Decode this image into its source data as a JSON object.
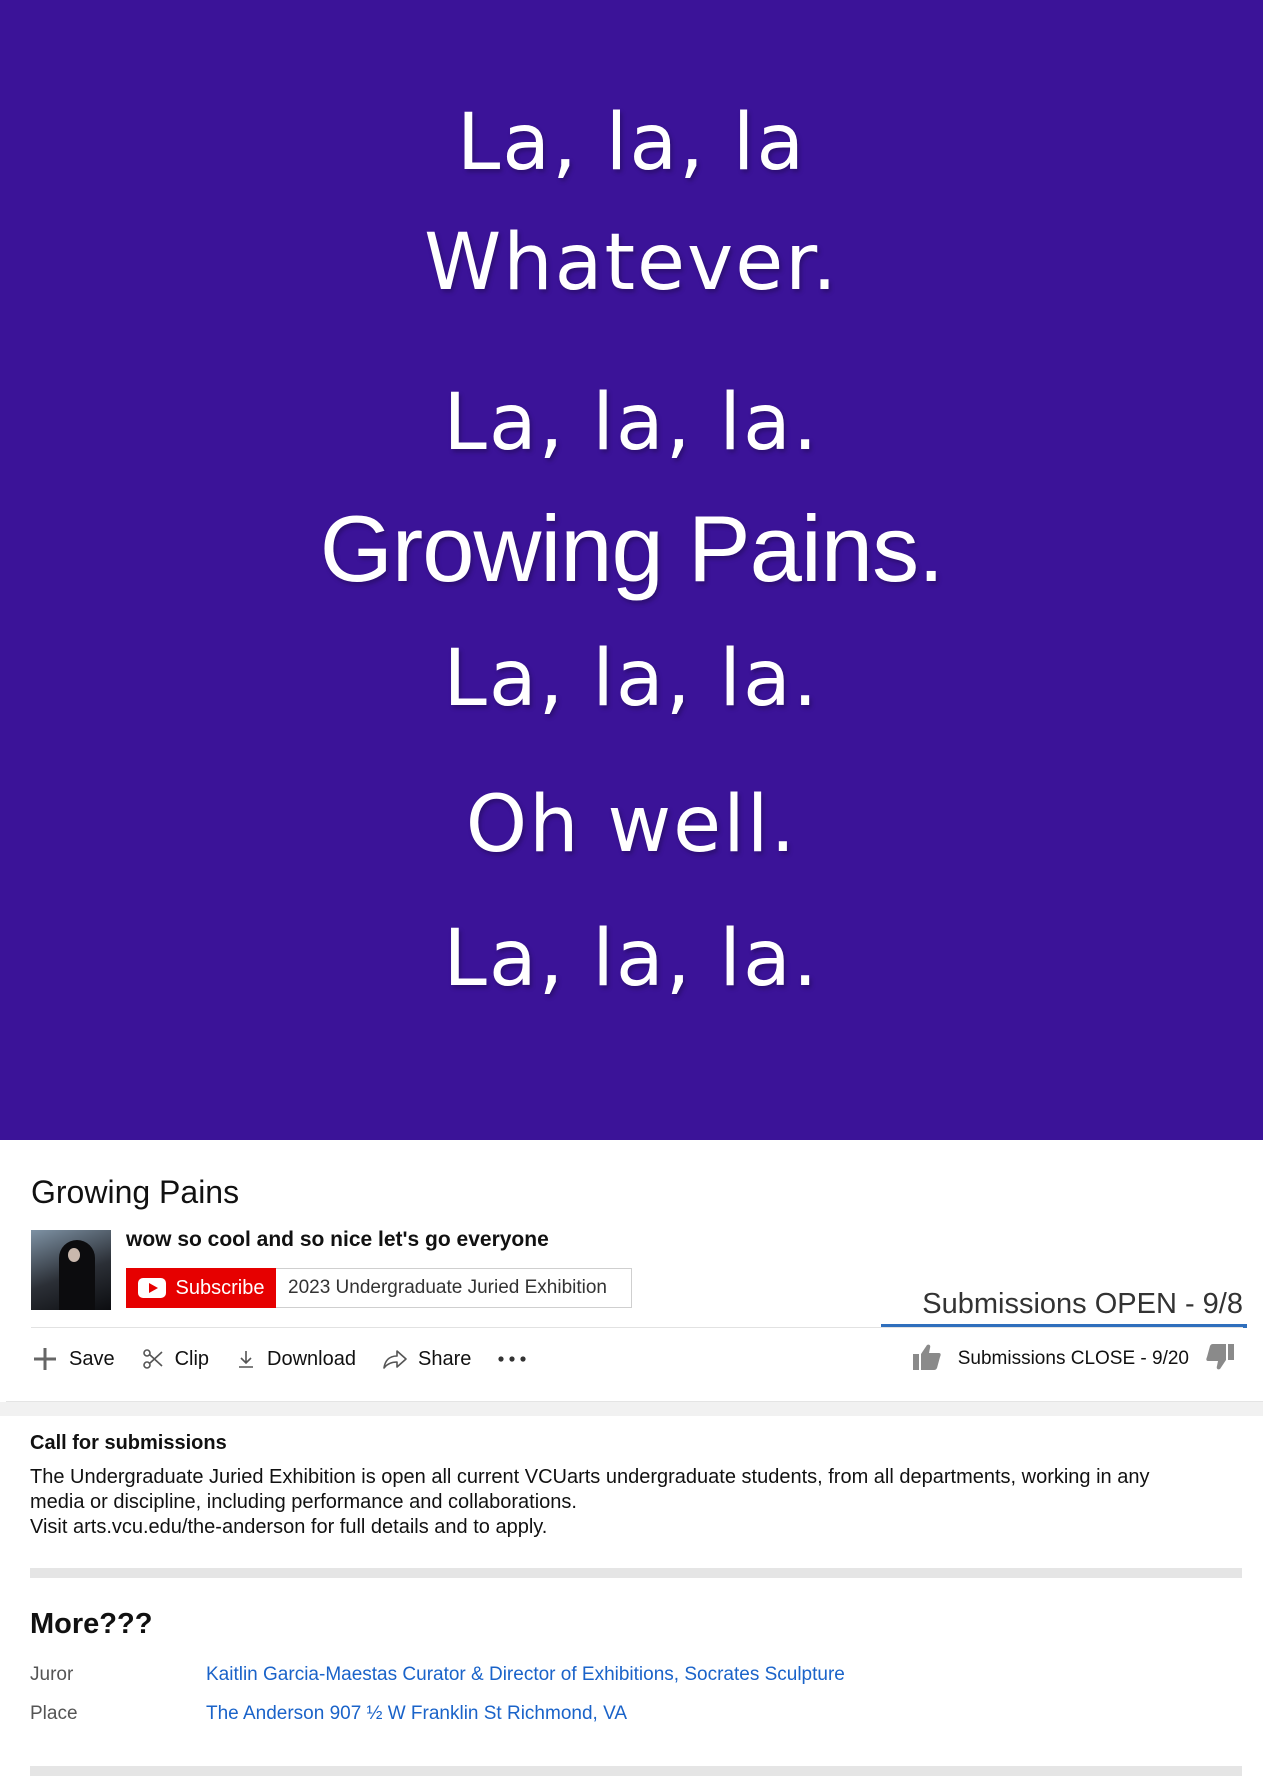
{
  "video": {
    "background_color": "#3b1398",
    "lines": [
      {
        "text": "La, la, la"
      },
      {
        "text": "Whatever."
      },
      {
        "text": "La, la, la."
      },
      {
        "text": "Growing Pains."
      },
      {
        "text": "La, la, la."
      },
      {
        "text": "Oh well."
      },
      {
        "text": "La, la, la."
      }
    ]
  },
  "info": {
    "title": "Growing Pains",
    "channel_name": "wow so cool and so nice let's go everyone",
    "subscribe_label": "Subscribe",
    "subscriber_text": "2023 Undergraduate Juried Exhibition",
    "views_text": "Submissions OPEN - 9/8",
    "actions": {
      "save": "Save",
      "clip": "Clip",
      "download": "Download",
      "share": "Share"
    },
    "rating_text": "Submissions CLOSE - 9/20",
    "accent_color": "#2f6fbd",
    "subscribe_color": "#e60000"
  },
  "description": {
    "heading": "Call for submissions",
    "body_lines": [
      "The Undergraduate Juried Exhibition is open all current VCUarts undergraduate students, from all departments, working in any",
      "media or discipline, including performance and collaborations.",
      "Visit arts.vcu.edu/the-anderson for full details and to apply."
    ]
  },
  "more": {
    "heading": "More???",
    "rows": [
      {
        "label": "Juror",
        "value": "Kaitlin Garcia-Maestas Curator & Director of Exhibitions, Socrates Sculpture"
      },
      {
        "label": "Place",
        "value": "The Anderson 907 ½ W Franklin St Richmond, VA"
      }
    ]
  },
  "icons": [
    "plus-icon",
    "scissors-icon",
    "download-icon",
    "share-icon",
    "more-dots-icon",
    "thumbs-up-icon",
    "thumbs-down-icon",
    "youtube-logo-icon"
  ]
}
